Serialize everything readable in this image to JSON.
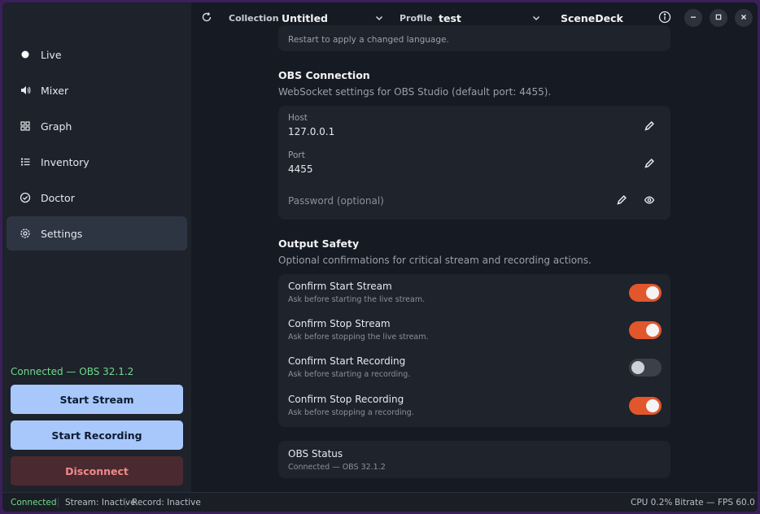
{
  "topbar": {
    "collection_label": "Collection",
    "collection_value": "Untitled",
    "profile_label": "Profile",
    "profile_value": "test",
    "app_title": "SceneDeck"
  },
  "sidebar": {
    "items": [
      {
        "label": "Live",
        "icon": "dot-icon"
      },
      {
        "label": "Mixer",
        "icon": "speaker-icon"
      },
      {
        "label": "Graph",
        "icon": "grid-icon"
      },
      {
        "label": "Inventory",
        "icon": "list-icon"
      },
      {
        "label": "Doctor",
        "icon": "check-circle-icon"
      },
      {
        "label": "Settings",
        "icon": "gear-icon",
        "active": true
      }
    ],
    "connection_text": "Connected — OBS 32.1.2",
    "start_stream": "Start Stream",
    "start_recording": "Start Recording",
    "disconnect": "Disconnect"
  },
  "language_card": {
    "note": "Restart to apply a changed language."
  },
  "obs_connection": {
    "title": "OBS Connection",
    "subtitle": "WebSocket settings for OBS Studio (default port: 4455).",
    "host_label": "Host",
    "host_value": "127.0.0.1",
    "port_label": "Port",
    "port_value": "4455",
    "password_placeholder": "Password (optional)"
  },
  "output_safety": {
    "title": "Output Safety",
    "subtitle": "Optional confirmations for critical stream and recording actions.",
    "toggles": [
      {
        "title": "Confirm Start Stream",
        "desc": "Ask before starting the live stream.",
        "on": true
      },
      {
        "title": "Confirm Stop Stream",
        "desc": "Ask before stopping the live stream.",
        "on": true
      },
      {
        "title": "Confirm Start Recording",
        "desc": "Ask before starting a recording.",
        "on": false
      },
      {
        "title": "Confirm Stop Recording",
        "desc": "Ask before stopping a recording.",
        "on": true
      }
    ]
  },
  "obs_status": {
    "title": "OBS Status",
    "value": "Connected — OBS 32.1.2"
  },
  "statusbar": {
    "connected": "Connected",
    "stream": "Stream: Inactive",
    "record": "Record: Inactive",
    "cpu": "CPU 0.2%",
    "bitrate": "Bitrate —",
    "fps": "FPS 60.0"
  },
  "colors": {
    "accent_toggle": "#e2562b",
    "primary_button": "#a8c8fb",
    "connected_green": "#6fdc8c",
    "danger_text": "#ef8a8a"
  }
}
